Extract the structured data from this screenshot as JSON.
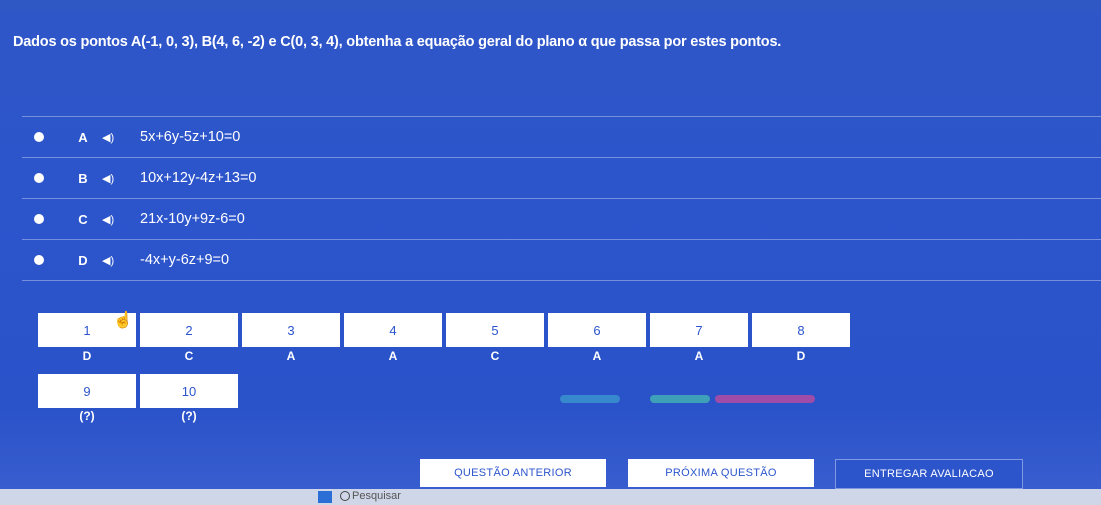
{
  "question": {
    "text": "Dados os pontos A(-1, 0, 3), B(4, 6, -2) e C(0, 3, 4), obtenha a equação geral do plano α que passa por estes pontos."
  },
  "options": [
    {
      "letter": "A",
      "formula": "5x+6y-5z+10=0"
    },
    {
      "letter": "B",
      "formula": "10x+12y-4z+13=0"
    },
    {
      "letter": "C",
      "formula": "21x-10y+9z-6=0"
    },
    {
      "letter": "D",
      "formula": "-4x+y-6z+9=0"
    }
  ],
  "answers": [
    {
      "number": "1",
      "answer": "D"
    },
    {
      "number": "2",
      "answer": "C"
    },
    {
      "number": "3",
      "answer": "A"
    },
    {
      "number": "4",
      "answer": "A"
    },
    {
      "number": "5",
      "answer": "C"
    },
    {
      "number": "6",
      "answer": "A"
    },
    {
      "number": "7",
      "answer": "A"
    },
    {
      "number": "8",
      "answer": "D"
    },
    {
      "number": "9",
      "answer": "(?)"
    },
    {
      "number": "10",
      "answer": "(?)"
    }
  ],
  "buttons": {
    "prev": "QUESTÃO ANTERIOR",
    "next": "PRÓXIMA QUESTÃO",
    "submit": "ENTREGAR AVALIACAO"
  },
  "taskbar": {
    "search_placeholder": "Pesquisar"
  },
  "icons": {
    "sound": "speaker-icon",
    "cursor": "hand-cursor-icon"
  }
}
